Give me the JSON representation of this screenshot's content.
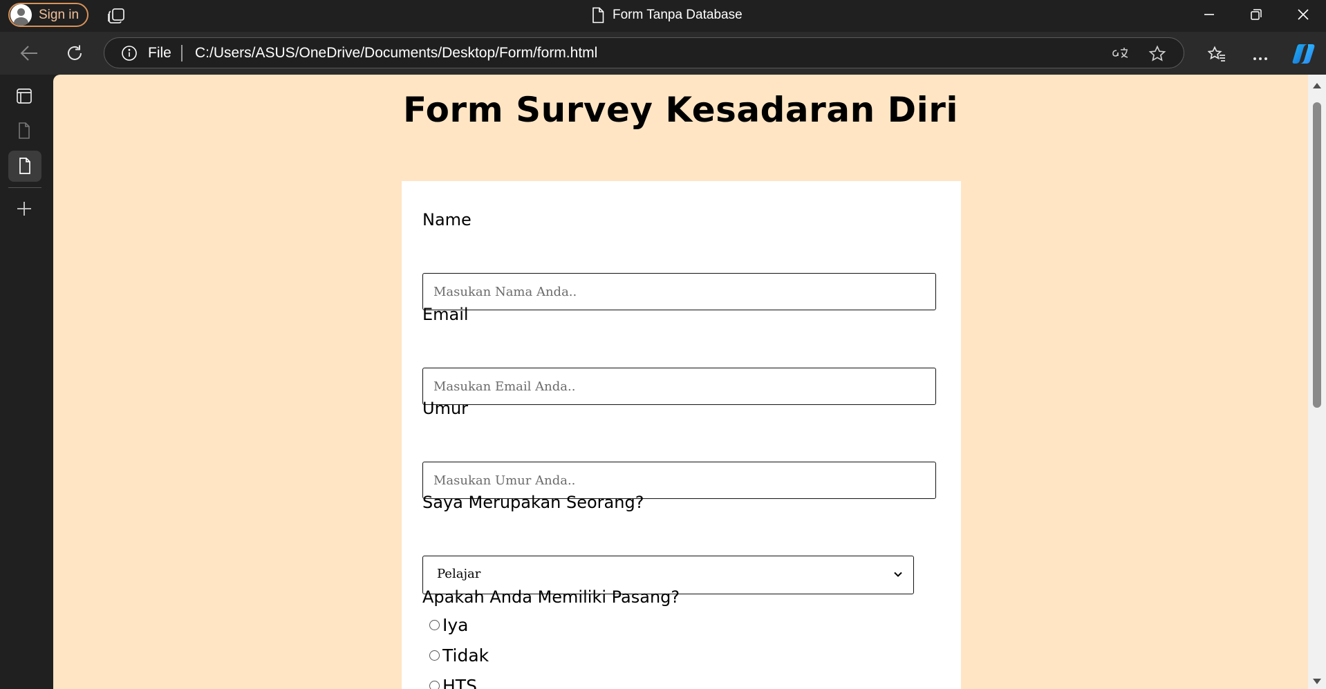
{
  "browser": {
    "sign_in_label": "Sign in",
    "tab_title": "Form Tanpa Database",
    "address": {
      "scheme_label": "File",
      "url": "C:/Users/ASUS/OneDrive/Documents/Desktop/Form/form.html"
    },
    "accent_color": "#d9935a"
  },
  "page": {
    "background_color": "#ffe5c4",
    "title": "Form Survey Kesadaran Diri",
    "form": {
      "name_label": "Name",
      "name_placeholder": "Masukan Nama Anda..",
      "email_label": "Email",
      "email_placeholder": "Masukan Email Anda..",
      "age_label": "Umur",
      "age_placeholder": "Masukan Umur Anda..",
      "role_label": "Saya Merupakan Seorang?",
      "role_selected": "Pelajar",
      "partner_label": "Apakah Anda Memiliki Pasang?",
      "partner_options": [
        "Iya",
        "Tidak",
        "HTS"
      ]
    }
  }
}
